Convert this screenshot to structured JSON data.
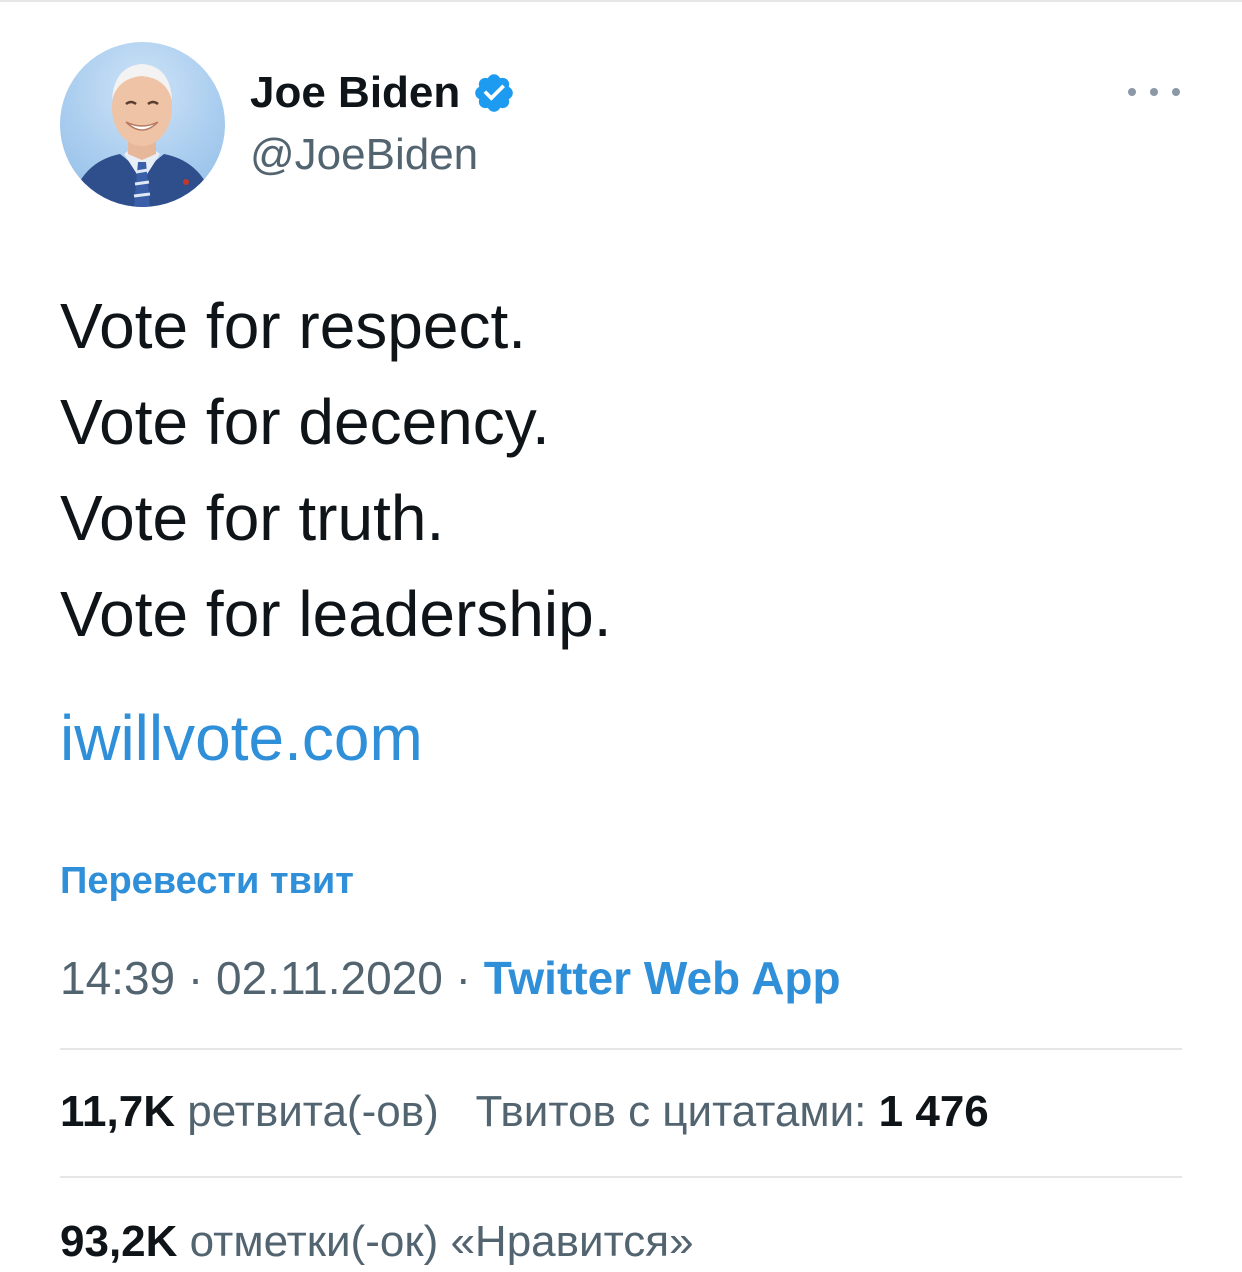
{
  "tweet": {
    "author": {
      "name": "Joe Biden",
      "handle": "@JoeBiden",
      "verified": true
    },
    "text_lines": [
      "Vote for respect.",
      "Vote for decency.",
      "Vote for truth.",
      "Vote for leadership."
    ],
    "link": "iwillvote.com",
    "translate_label": "Перевести твит",
    "meta": {
      "time": "14:39",
      "separator": "·",
      "date": "02.11.2020",
      "source": "Twitter Web App"
    },
    "stats": {
      "retweets_count": "11,7K",
      "retweets_label": "ретвита(-ов)",
      "quotes_label": "Твитов с цитатами:",
      "quotes_count": "1 476",
      "likes_count": "93,2K",
      "likes_label": "отметки(-ок) «Нравится»"
    }
  },
  "icons": {
    "verified": "verified-badge-icon",
    "more": "more-horizontal-icon"
  },
  "colors": {
    "accent": "#2f8fd8",
    "text_primary": "#0f1419",
    "text_secondary": "#536471",
    "divider": "#e6e6e6"
  }
}
